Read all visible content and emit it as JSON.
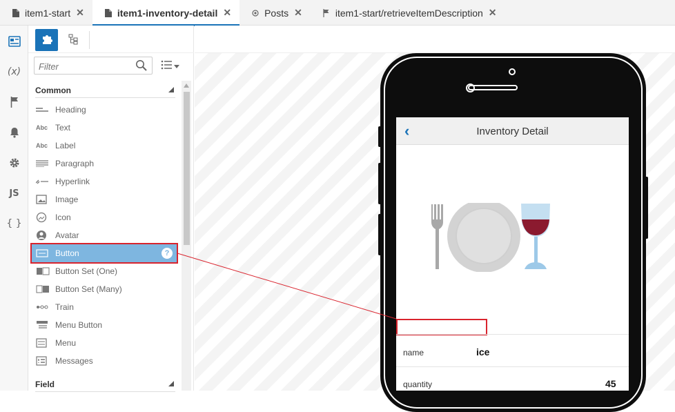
{
  "tabs": [
    {
      "label": "item1-start",
      "icon": "file-icon",
      "active": false
    },
    {
      "label": "item1-inventory-detail",
      "icon": "file-icon",
      "active": true
    },
    {
      "label": "Posts",
      "icon": "circle-dot-icon",
      "active": false
    },
    {
      "label": "item1-start/retrieveItemDescription",
      "icon": "flag-icon",
      "active": false
    }
  ],
  "rail": {
    "icons": [
      "components-icon",
      "variables-icon",
      "flag-icon",
      "bell-icon",
      "gear-icon",
      "js-icon",
      "braces-icon"
    ],
    "variables_label": "(x)",
    "js_label": "JS",
    "braces_label": "{ }"
  },
  "palette": {
    "filter_placeholder": "Filter",
    "section_common": "Common",
    "section_field": "Field",
    "items": [
      {
        "label": "Heading",
        "icon": "heading-icon"
      },
      {
        "label": "Text",
        "icon": "text-icon"
      },
      {
        "label": "Label",
        "icon": "label-icon"
      },
      {
        "label": "Paragraph",
        "icon": "paragraph-icon"
      },
      {
        "label": "Hyperlink",
        "icon": "hyperlink-icon"
      },
      {
        "label": "Image",
        "icon": "image-icon"
      },
      {
        "label": "Icon",
        "icon": "icon-icon"
      },
      {
        "label": "Avatar",
        "icon": "avatar-icon"
      },
      {
        "label": "Button",
        "icon": "button-icon",
        "selected": true
      },
      {
        "label": "Button Set (One)",
        "icon": "button-set-one-icon"
      },
      {
        "label": "Button Set (Many)",
        "icon": "button-set-many-icon"
      },
      {
        "label": "Train",
        "icon": "train-icon"
      },
      {
        "label": "Menu Button",
        "icon": "menu-button-icon"
      },
      {
        "label": "Menu",
        "icon": "menu-icon"
      },
      {
        "label": "Messages",
        "icon": "messages-icon"
      }
    ],
    "help_label": "?"
  },
  "page": {
    "title": "Inventory Detail",
    "back_label": "‹",
    "fields": [
      {
        "label": "name",
        "value": "ice"
      },
      {
        "label": "quantity",
        "value": "45"
      }
    ]
  },
  "colors": {
    "accent": "#1a73b8",
    "selection": "#7eb6e0",
    "highlight_border": "#d9232d"
  }
}
